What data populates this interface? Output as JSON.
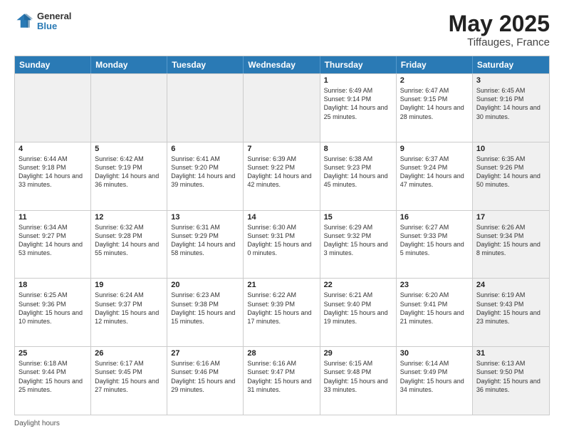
{
  "header": {
    "logo_line1": "General",
    "logo_line2": "Blue",
    "month_year": "May 2025",
    "location": "Tiffauges, France"
  },
  "days_of_week": [
    "Sunday",
    "Monday",
    "Tuesday",
    "Wednesday",
    "Thursday",
    "Friday",
    "Saturday"
  ],
  "footer_text": "Daylight hours",
  "rows": [
    [
      {
        "day": "",
        "info": "",
        "shaded": true
      },
      {
        "day": "",
        "info": "",
        "shaded": true
      },
      {
        "day": "",
        "info": "",
        "shaded": true
      },
      {
        "day": "",
        "info": "",
        "shaded": true
      },
      {
        "day": "1",
        "info": "Sunrise: 6:49 AM\nSunset: 9:14 PM\nDaylight: 14 hours and 25 minutes.",
        "shaded": false
      },
      {
        "day": "2",
        "info": "Sunrise: 6:47 AM\nSunset: 9:15 PM\nDaylight: 14 hours and 28 minutes.",
        "shaded": false
      },
      {
        "day": "3",
        "info": "Sunrise: 6:45 AM\nSunset: 9:16 PM\nDaylight: 14 hours and 30 minutes.",
        "shaded": true
      }
    ],
    [
      {
        "day": "4",
        "info": "Sunrise: 6:44 AM\nSunset: 9:18 PM\nDaylight: 14 hours and 33 minutes.",
        "shaded": false
      },
      {
        "day": "5",
        "info": "Sunrise: 6:42 AM\nSunset: 9:19 PM\nDaylight: 14 hours and 36 minutes.",
        "shaded": false
      },
      {
        "day": "6",
        "info": "Sunrise: 6:41 AM\nSunset: 9:20 PM\nDaylight: 14 hours and 39 minutes.",
        "shaded": false
      },
      {
        "day": "7",
        "info": "Sunrise: 6:39 AM\nSunset: 9:22 PM\nDaylight: 14 hours and 42 minutes.",
        "shaded": false
      },
      {
        "day": "8",
        "info": "Sunrise: 6:38 AM\nSunset: 9:23 PM\nDaylight: 14 hours and 45 minutes.",
        "shaded": false
      },
      {
        "day": "9",
        "info": "Sunrise: 6:37 AM\nSunset: 9:24 PM\nDaylight: 14 hours and 47 minutes.",
        "shaded": false
      },
      {
        "day": "10",
        "info": "Sunrise: 6:35 AM\nSunset: 9:26 PM\nDaylight: 14 hours and 50 minutes.",
        "shaded": true
      }
    ],
    [
      {
        "day": "11",
        "info": "Sunrise: 6:34 AM\nSunset: 9:27 PM\nDaylight: 14 hours and 53 minutes.",
        "shaded": false
      },
      {
        "day": "12",
        "info": "Sunrise: 6:32 AM\nSunset: 9:28 PM\nDaylight: 14 hours and 55 minutes.",
        "shaded": false
      },
      {
        "day": "13",
        "info": "Sunrise: 6:31 AM\nSunset: 9:29 PM\nDaylight: 14 hours and 58 minutes.",
        "shaded": false
      },
      {
        "day": "14",
        "info": "Sunrise: 6:30 AM\nSunset: 9:31 PM\nDaylight: 15 hours and 0 minutes.",
        "shaded": false
      },
      {
        "day": "15",
        "info": "Sunrise: 6:29 AM\nSunset: 9:32 PM\nDaylight: 15 hours and 3 minutes.",
        "shaded": false
      },
      {
        "day": "16",
        "info": "Sunrise: 6:27 AM\nSunset: 9:33 PM\nDaylight: 15 hours and 5 minutes.",
        "shaded": false
      },
      {
        "day": "17",
        "info": "Sunrise: 6:26 AM\nSunset: 9:34 PM\nDaylight: 15 hours and 8 minutes.",
        "shaded": true
      }
    ],
    [
      {
        "day": "18",
        "info": "Sunrise: 6:25 AM\nSunset: 9:36 PM\nDaylight: 15 hours and 10 minutes.",
        "shaded": false
      },
      {
        "day": "19",
        "info": "Sunrise: 6:24 AM\nSunset: 9:37 PM\nDaylight: 15 hours and 12 minutes.",
        "shaded": false
      },
      {
        "day": "20",
        "info": "Sunrise: 6:23 AM\nSunset: 9:38 PM\nDaylight: 15 hours and 15 minutes.",
        "shaded": false
      },
      {
        "day": "21",
        "info": "Sunrise: 6:22 AM\nSunset: 9:39 PM\nDaylight: 15 hours and 17 minutes.",
        "shaded": false
      },
      {
        "day": "22",
        "info": "Sunrise: 6:21 AM\nSunset: 9:40 PM\nDaylight: 15 hours and 19 minutes.",
        "shaded": false
      },
      {
        "day": "23",
        "info": "Sunrise: 6:20 AM\nSunset: 9:41 PM\nDaylight: 15 hours and 21 minutes.",
        "shaded": false
      },
      {
        "day": "24",
        "info": "Sunrise: 6:19 AM\nSunset: 9:43 PM\nDaylight: 15 hours and 23 minutes.",
        "shaded": true
      }
    ],
    [
      {
        "day": "25",
        "info": "Sunrise: 6:18 AM\nSunset: 9:44 PM\nDaylight: 15 hours and 25 minutes.",
        "shaded": false
      },
      {
        "day": "26",
        "info": "Sunrise: 6:17 AM\nSunset: 9:45 PM\nDaylight: 15 hours and 27 minutes.",
        "shaded": false
      },
      {
        "day": "27",
        "info": "Sunrise: 6:16 AM\nSunset: 9:46 PM\nDaylight: 15 hours and 29 minutes.",
        "shaded": false
      },
      {
        "day": "28",
        "info": "Sunrise: 6:16 AM\nSunset: 9:47 PM\nDaylight: 15 hours and 31 minutes.",
        "shaded": false
      },
      {
        "day": "29",
        "info": "Sunrise: 6:15 AM\nSunset: 9:48 PM\nDaylight: 15 hours and 33 minutes.",
        "shaded": false
      },
      {
        "day": "30",
        "info": "Sunrise: 6:14 AM\nSunset: 9:49 PM\nDaylight: 15 hours and 34 minutes.",
        "shaded": false
      },
      {
        "day": "31",
        "info": "Sunrise: 6:13 AM\nSunset: 9:50 PM\nDaylight: 15 hours and 36 minutes.",
        "shaded": true
      }
    ]
  ]
}
